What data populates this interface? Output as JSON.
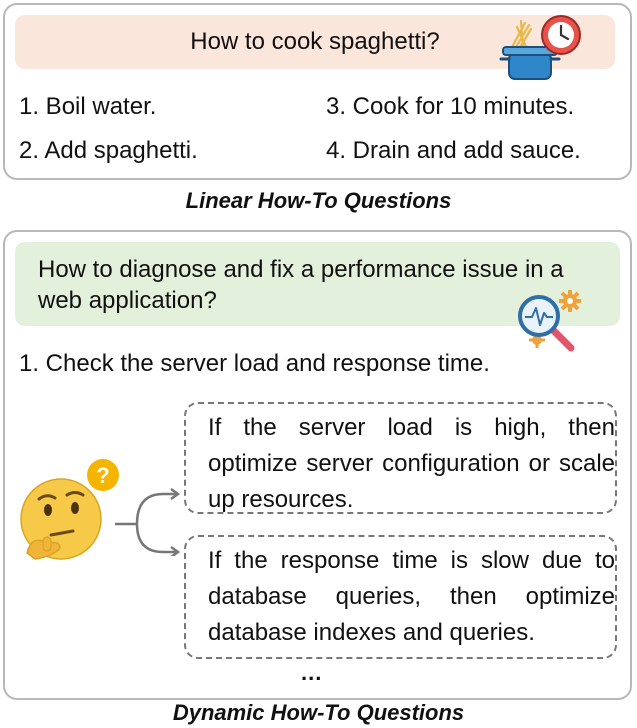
{
  "linear": {
    "question": "How to cook spaghetti?",
    "steps": [
      "1. Boil water.",
      "2. Add spaghetti.",
      "3. Cook for 10 minutes.",
      "4. Drain and add sauce."
    ],
    "caption": "Linear How-To Questions"
  },
  "dynamic": {
    "question": "How to diagnose and fix a performance issue in a web application?",
    "step1": "1. Check the server load and response time.",
    "branches": [
      "If the server load is high, then optimize server configuration or scale up resources.",
      "If the response time is slow due to database queries, then optimize database indexes and queries."
    ],
    "ellipsis": "...",
    "caption": "Dynamic How-To Questions"
  },
  "icons": {
    "cooking": "cooking-pot-clock-icon",
    "diagnose": "magnifier-gears-icon",
    "thinking": "thinking-face-icon"
  },
  "colors": {
    "linear_question_bg": "#fae6db",
    "dynamic_question_bg": "#e3f1dc",
    "panel_border": "#b8b8b8",
    "branch_border": "#777777"
  }
}
